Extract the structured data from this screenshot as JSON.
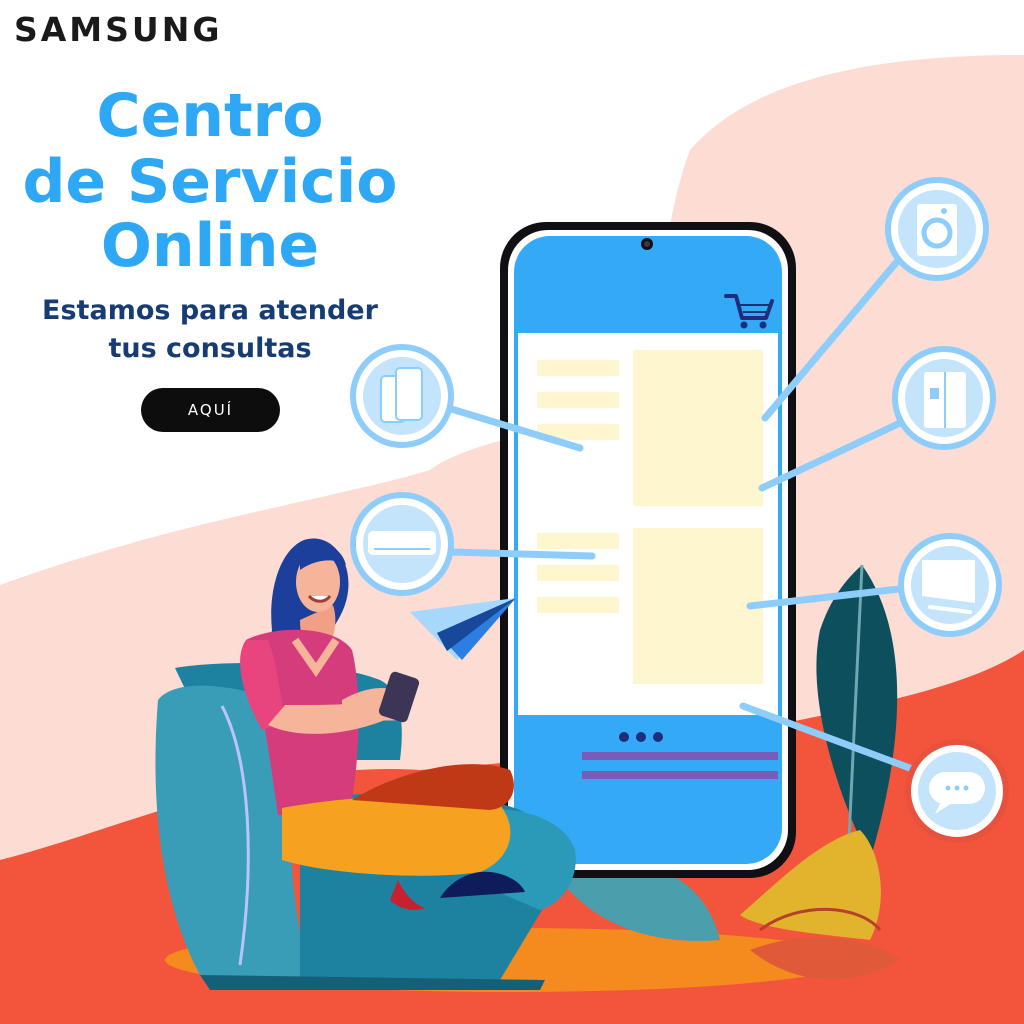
{
  "brand": {
    "name": "SAMSUNG"
  },
  "headline": {
    "line1": "Centro",
    "line2": "de Servicio",
    "line3": "Online"
  },
  "subheadline": {
    "line1": "Estamos para atender",
    "line2": "tus consultas"
  },
  "cta": {
    "label": "AQUÍ"
  },
  "icons": [
    "washing-machine-icon",
    "refrigerator-icon",
    "monitor-icon",
    "chat-icon",
    "mobile-devices-icon",
    "air-conditioner-icon",
    "shopping-cart-icon",
    "paper-plane-icon"
  ],
  "colors": {
    "headline": "#2ea8f4",
    "subheadline": "#173c73",
    "button": "#0d0d0d",
    "phone_screen": "#34a9f6",
    "background_blob": "#fcdcd3",
    "floor": "#f2553c"
  }
}
